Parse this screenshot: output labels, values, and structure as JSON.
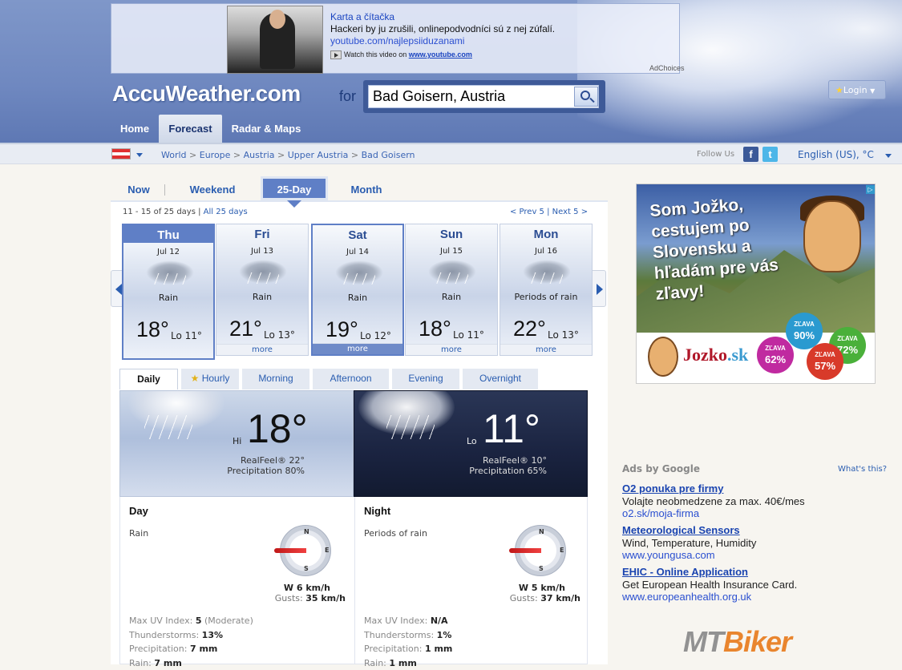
{
  "top_ad": {
    "title": "Karta a čítačka",
    "description": "Hackeri by ju zrušili, onlinepodvodníci sú z nej zúfalí.",
    "url": "youtube.com/najlepsiiduzanami",
    "watch_prefix": "Watch this video on",
    "watch_link": "www.youtube.com",
    "adchoices": "AdChoices"
  },
  "header": {
    "logo": "AccuWeather.com",
    "for_label": "for",
    "search_value": "Bad Goisern, Austria",
    "login_label": "Login"
  },
  "nav": [
    "Home",
    "Forecast",
    "Radar & Maps"
  ],
  "breadcrumb": [
    "World",
    "Europe",
    "Austria",
    "Upper Austria",
    "Bad Goisern"
  ],
  "follow_label": "Follow Us",
  "language": "English (US), °C",
  "tabs": [
    "Now",
    "Weekend",
    "25-Day",
    "Month"
  ],
  "range": {
    "text": "11 - 15 of 25 days",
    "sep": "|",
    "all": "All 25 days",
    "prev": "< Prev 5",
    "next": "Next 5 >"
  },
  "days": [
    {
      "name": "Thu",
      "date": "Jul 12",
      "cond": "Rain",
      "hi": "18°",
      "lo": "Lo 11°",
      "more": ""
    },
    {
      "name": "Fri",
      "date": "Jul 13",
      "cond": "Rain",
      "hi": "21°",
      "lo": "Lo 13°",
      "more": "more"
    },
    {
      "name": "Sat",
      "date": "Jul 14",
      "cond": "Rain",
      "hi": "19°",
      "lo": "Lo 12°",
      "more": "more"
    },
    {
      "name": "Sun",
      "date": "Jul 15",
      "cond": "Rain",
      "hi": "18°",
      "lo": "Lo 11°",
      "more": "more"
    },
    {
      "name": "Mon",
      "date": "Jul 16",
      "cond": "Periods of rain",
      "hi": "22°",
      "lo": "Lo 13°",
      "more": "more"
    }
  ],
  "subtabs": [
    "Daily",
    "Hourly",
    "Morning",
    "Afternoon",
    "Evening",
    "Overnight"
  ],
  "day_panel": {
    "label": "Hi",
    "temp": "18°",
    "realfeel": "RealFeel® 22°",
    "precip": "Precipitation 80%"
  },
  "night_panel": {
    "label": "Lo",
    "temp": "11°",
    "realfeel": "RealFeel® 10°",
    "precip": "Precipitation 65%"
  },
  "day_detail": {
    "title": "Day",
    "cond": "Rain",
    "wind": "W 6 km/h",
    "gusts_label": "Gusts:",
    "gusts": "35 km/h",
    "uv_label": "Max UV Index:",
    "uv": "5",
    "uv_note": "(Moderate)",
    "thunder_label": "Thunderstorms:",
    "thunder": "13%",
    "precip_label": "Precipitation:",
    "precip": "7 mm",
    "rain_label": "Rain:",
    "rain": "7 mm"
  },
  "night_detail": {
    "title": "Night",
    "cond": "Periods of rain",
    "wind": "W 5 km/h",
    "gusts_label": "Gusts:",
    "gusts": "37 km/h",
    "uv_label": "Max UV Index:",
    "uv": "N/A",
    "thunder_label": "Thunderstorms:",
    "thunder": "1%",
    "precip_label": "Precipitation:",
    "precip": "1 mm",
    "rain_label": "Rain:",
    "rain": "1 mm"
  },
  "compass": {
    "n": "N",
    "e": "E",
    "s": "S"
  },
  "side_ad": {
    "headline": "Som Jožko, cestujem po Slovensku a hľadám pre vás zľavy!",
    "brand": "Jozko",
    "brand_tld": ".sk",
    "badge_word": "ZĽAVA",
    "badges": [
      "90%",
      "72%",
      "62%",
      "57%"
    ]
  },
  "google_ads": {
    "header": "Ads by Google",
    "what": "What's this?",
    "items": [
      {
        "title": "O2 ponuka pre firmy",
        "desc": "Volajte neobmedzene za max. 40€/mes",
        "url": "o2.sk/moja-firma"
      },
      {
        "title": "Meteorological Sensors",
        "desc": "Wind, Temperature, Humidity",
        "url": "www.youngusa.com"
      },
      {
        "title": "EHIC - Online Application",
        "desc": "Get European Health Insurance Card.",
        "url": "www.europeanhealth.org.uk"
      }
    ]
  },
  "watermark": {
    "a": "MT",
    "b": "Biker"
  }
}
